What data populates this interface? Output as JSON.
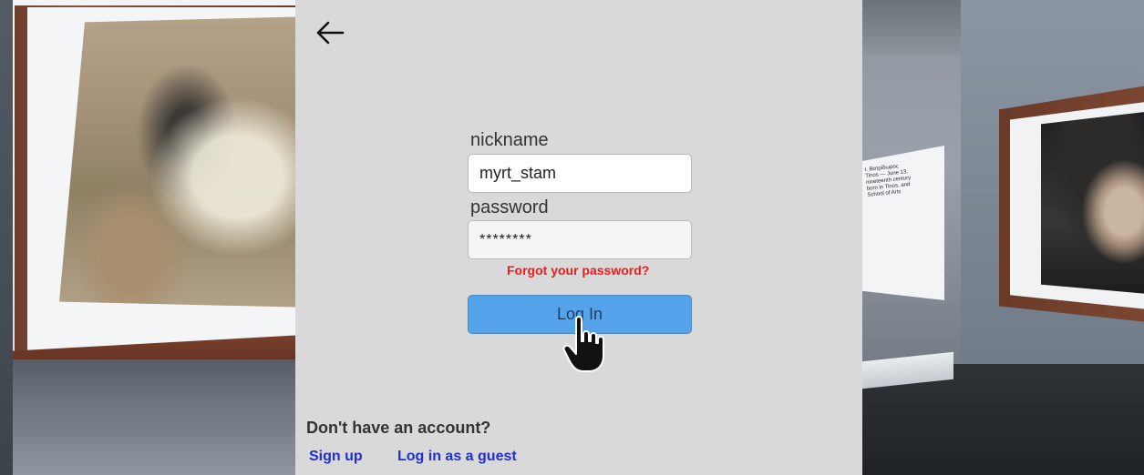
{
  "login": {
    "nickname_label": "nickname",
    "nickname_value": "myrt_stam",
    "password_label": "password",
    "password_value": "********",
    "forgot_password": "Forgot your password?",
    "login_button": "Log In",
    "no_account_text": "Don't have an account?",
    "signup_link": "Sign up",
    "guest_link": "Log in as a guest"
  },
  "icons": {
    "back": "back-arrow-icon",
    "cursor": "hand-pointer-icon"
  },
  "background": {
    "info_plaque_text": "r. Βατρίδωρος\nTinos — June 13,\nnineteenth century\nborn in Tinos, and\nSchool of Arts"
  },
  "colors": {
    "panel_bg": "#d9d9d9",
    "login_button": "#55a3eb",
    "forgot_link": "#ee1c1c",
    "links": "#1f2ed6"
  }
}
